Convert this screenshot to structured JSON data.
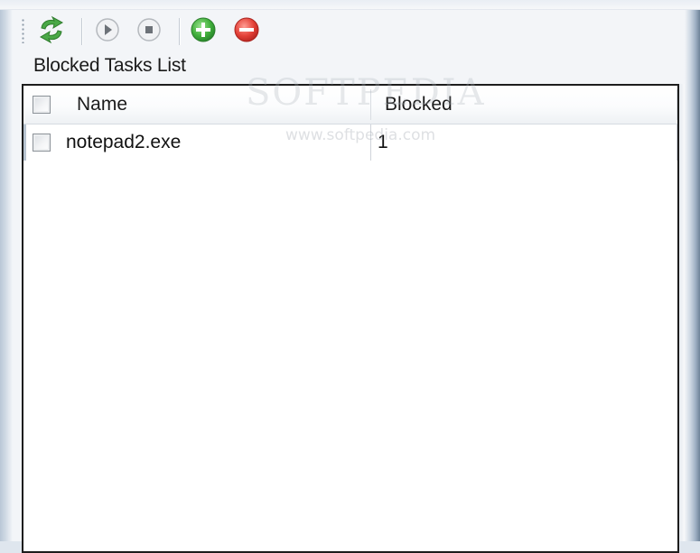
{
  "toolbar": {
    "icons": [
      "refresh-icon",
      "play-icon",
      "stop-icon",
      "add-icon",
      "remove-icon"
    ],
    "colors": {
      "refresh": "#3e9a3c",
      "add": "#3ea83b",
      "remove": "#e0413a",
      "disabled": "#b9bdc2"
    }
  },
  "section": {
    "label": "Blocked Tasks List"
  },
  "list": {
    "columns": [
      "Name",
      "Blocked"
    ],
    "rows": [
      {
        "name": "notepad2.exe",
        "blocked": "1"
      }
    ]
  },
  "watermark": {
    "brand": "SOFTPEDIA",
    "url": "www.softpedia.com"
  }
}
